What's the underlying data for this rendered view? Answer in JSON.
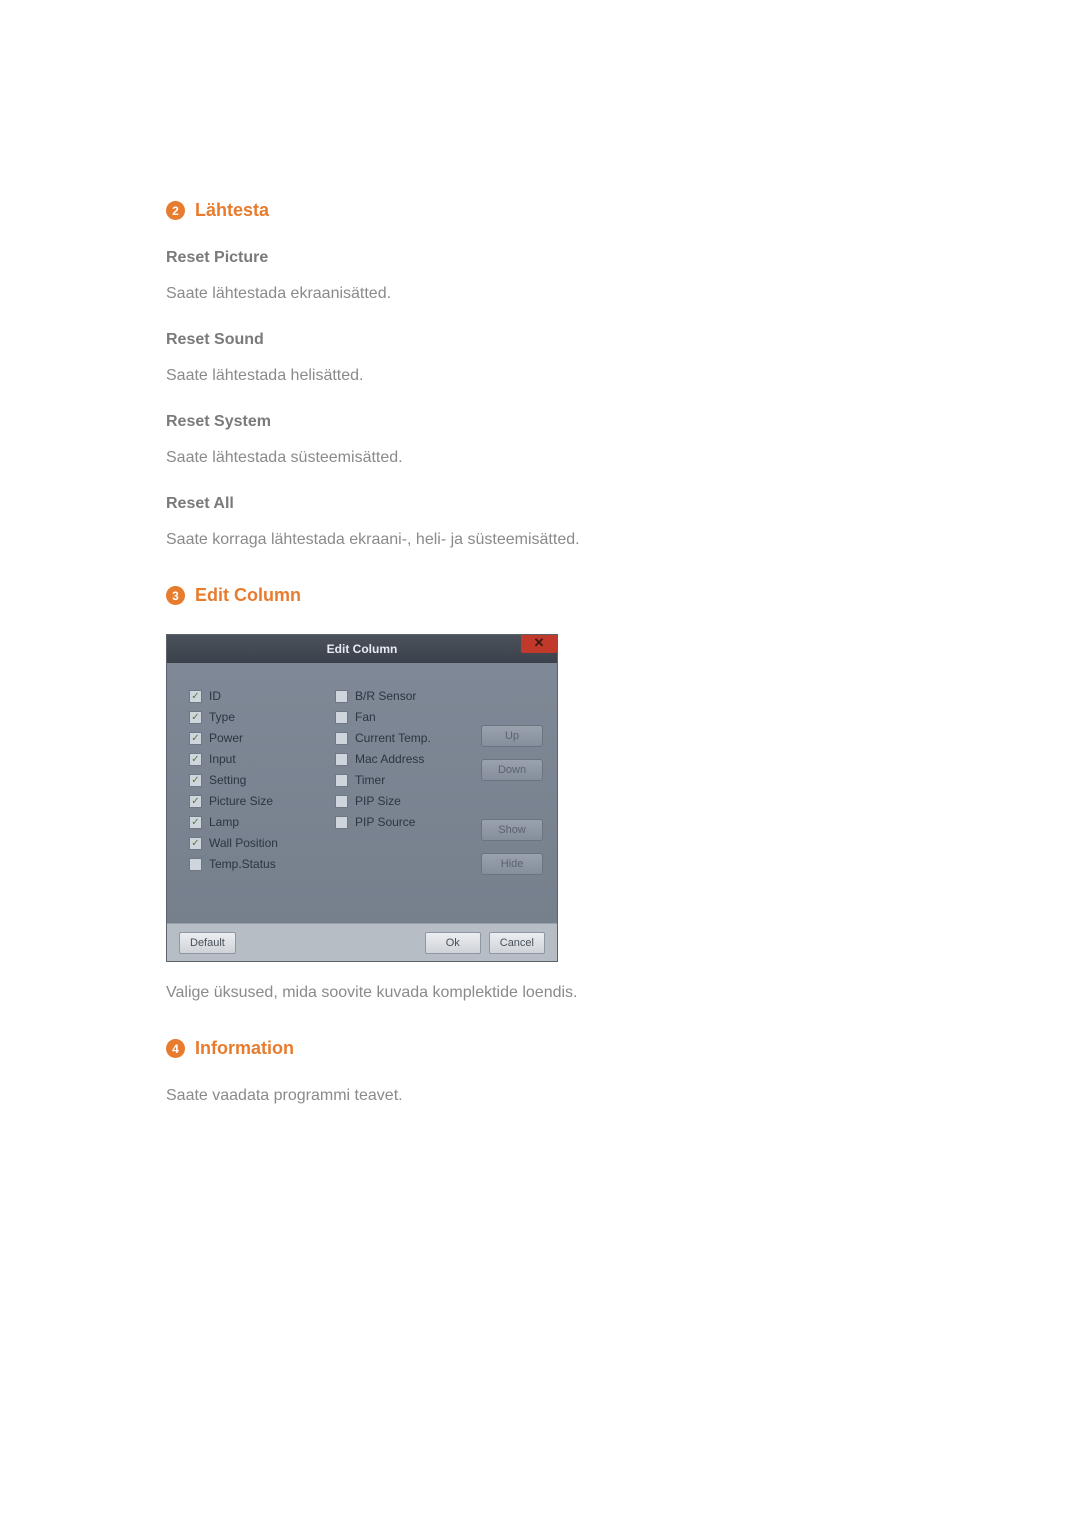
{
  "sections": {
    "s2": {
      "num": "2",
      "title": "Lähtesta"
    },
    "s3": {
      "num": "3",
      "title": "Edit Column"
    },
    "s4": {
      "num": "4",
      "title": "Information"
    }
  },
  "reset": {
    "picture_h": "Reset Picture",
    "picture_t": "Saate lähtestada ekraanisätted.",
    "sound_h": "Reset Sound",
    "sound_t": "Saate lähtestada helisätted.",
    "system_h": "Reset System",
    "system_t": "Saate lähtestada süsteemisätted.",
    "all_h": "Reset All",
    "all_t": "Saate korraga lähtestada ekraani-, heli- ja süsteemisätted."
  },
  "dialog": {
    "title": "Edit Column",
    "close": "✕",
    "col1": [
      {
        "label": "ID",
        "checked": true
      },
      {
        "label": "Type",
        "checked": true
      },
      {
        "label": "Power",
        "checked": true
      },
      {
        "label": "Input",
        "checked": true
      },
      {
        "label": "Setting",
        "checked": true
      },
      {
        "label": "Picture Size",
        "checked": true
      },
      {
        "label": "Lamp",
        "checked": true
      },
      {
        "label": "Wall Position",
        "checked": true
      },
      {
        "label": "Temp.Status",
        "checked": false
      }
    ],
    "col2": [
      {
        "label": "B/R Sensor",
        "checked": false
      },
      {
        "label": "Fan",
        "checked": false
      },
      {
        "label": "Current Temp.",
        "checked": false
      },
      {
        "label": "Mac Address",
        "checked": false
      },
      {
        "label": "Timer",
        "checked": false
      },
      {
        "label": "PIP Size",
        "checked": false
      },
      {
        "label": "PIP Source",
        "checked": false
      }
    ],
    "side": {
      "up": "Up",
      "down": "Down",
      "show": "Show",
      "hide": "Hide"
    },
    "footer": {
      "default": "Default",
      "ok": "Ok",
      "cancel": "Cancel"
    }
  },
  "edit_caption": "Valige üksused, mida soovite kuvada komplektide loendis.",
  "info_text": "Saate vaadata programmi teavet."
}
